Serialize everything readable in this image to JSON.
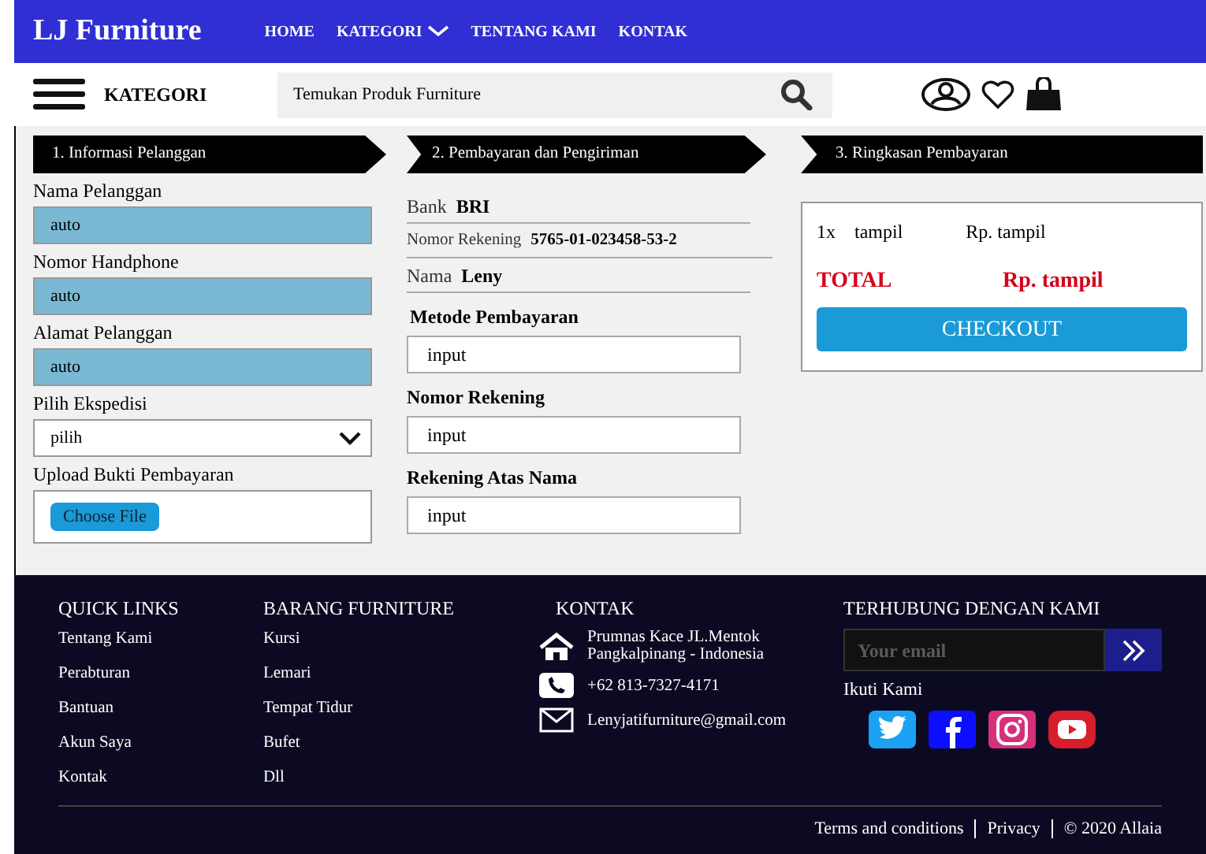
{
  "navbar": {
    "brand": "LJ Furniture",
    "links": [
      {
        "label": "HOME",
        "dropdown": false
      },
      {
        "label": "KATEGORI",
        "dropdown": true
      },
      {
        "label": "TENTANG KAMI",
        "dropdown": false
      },
      {
        "label": "KONTAK",
        "dropdown": false
      }
    ]
  },
  "toolbar": {
    "category_label": "KATEGORI",
    "search": {
      "placeholder": "Temukan Produk Furniture"
    }
  },
  "steps": [
    "1. Informasi Pelanggan",
    "2. Pembayaran dan Pengiriman",
    "3. Ringkasan Pembayaran"
  ],
  "customer_form": [
    {
      "kind": "text",
      "label": "Nama Pelanggan",
      "value": "auto"
    },
    {
      "kind": "text",
      "label": "Nomor Handphone",
      "value": "auto"
    },
    {
      "kind": "text",
      "label": "Alamat Pelanggan",
      "value": "auto"
    },
    {
      "kind": "select",
      "label": "Pilih Ekspedisi",
      "value": "pilih"
    },
    {
      "kind": "file",
      "label": "Upload Bukti Pembayaran",
      "button": "Choose File"
    }
  ],
  "bank_info": [
    {
      "label": "Bank",
      "value": "BRI"
    },
    {
      "label": "Nomor Rekening",
      "value": "5765-01-023458-53-2"
    },
    {
      "label": "Nama",
      "value": "Leny"
    }
  ],
  "payment_form": [
    {
      "label": "Metode Pembayaran",
      "value": "input"
    },
    {
      "label": "Nomor Rekening",
      "value": "input"
    },
    {
      "label": "Rekening Atas Nama",
      "value": "input"
    }
  ],
  "summary": {
    "qty": "1x",
    "item": "tampil",
    "price": "Rp. tampil",
    "total_label": "TOTAL",
    "total_value": "Rp. tampil",
    "button": "CHECKOUT"
  },
  "footer": {
    "quick_links": {
      "title": "QUICK LINKS",
      "items": [
        "Tentang Kami",
        "Perabturan",
        "Bantuan",
        "Akun Saya",
        "Kontak"
      ]
    },
    "furniture": {
      "title": "BARANG FURNITURE",
      "items": [
        "Kursi",
        "Lemari",
        "Tempat Tidur",
        "Bufet",
        "Dll"
      ]
    },
    "contact": {
      "title": "KONTAK",
      "items": [
        {
          "kind": "address",
          "text": "Prumnas Kace JL.Mentok Pangkalpinang - Indonesia"
        },
        {
          "kind": "phone",
          "text": "+62 813-7327-4171"
        },
        {
          "kind": "email",
          "text": "Lenyjatifurniture@gmail.com"
        }
      ]
    },
    "connect": {
      "title": "TERHUBUNG DENGAN KAMI",
      "email_placeholder": "Your email",
      "follow_label": "Ikuti Kami",
      "socials": [
        {
          "kind": "twitter"
        },
        {
          "kind": "facebook"
        },
        {
          "kind": "instagram"
        },
        {
          "kind": "youtube"
        }
      ]
    },
    "bottom_links": [
      "Terms and conditions",
      "Privacy",
      "© 2020 Allaia"
    ]
  }
}
